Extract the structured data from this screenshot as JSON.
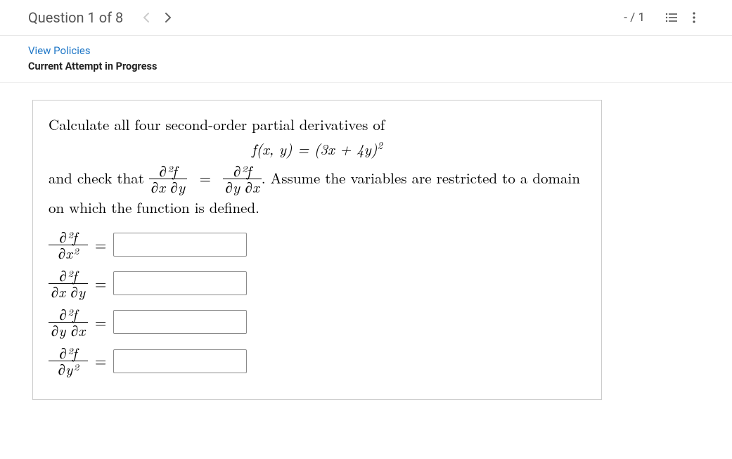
{
  "header": {
    "question_label": "Question 1 of 8",
    "score": "- / 1"
  },
  "meta": {
    "view_policies": "View Policies",
    "attempt_status": "Current Attempt in Progress"
  },
  "question": {
    "intro": "Calculate all four second-order partial derivatives of",
    "function_lhs": "f(x, y) = ",
    "function_rhs_base": "(3x + 4y)",
    "function_rhs_exp": "2",
    "check_pre": "and check that ",
    "mixed1_num": "∂²f",
    "mixed1_den": "∂x ∂y",
    "mixed2_num": "∂²f",
    "mixed2_den": "∂y ∂x",
    "check_post": ". Assume the variables are restricted to a domain on which the function is defined."
  },
  "answers": [
    {
      "num": "∂²f",
      "den": "∂x²",
      "value": ""
    },
    {
      "num": "∂²f",
      "den": "∂x ∂y",
      "value": ""
    },
    {
      "num": "∂²f",
      "den": "∂y ∂x",
      "value": ""
    },
    {
      "num": "∂²f",
      "den": "∂y²",
      "value": ""
    }
  ]
}
